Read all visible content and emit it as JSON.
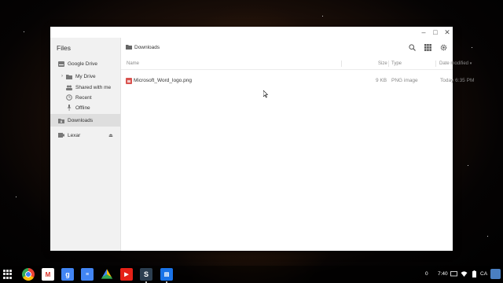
{
  "window": {
    "app_title": "Files",
    "controls": {
      "minimize": "–",
      "maximize": "□",
      "close": "✕"
    }
  },
  "sidebar": {
    "items": [
      {
        "label": "Google Drive",
        "icon": "drive-icon"
      },
      {
        "label": "My Drive",
        "icon": "folder-icon"
      },
      {
        "label": "Shared with me",
        "icon": "people-icon"
      },
      {
        "label": "Recent",
        "icon": "clock-icon"
      },
      {
        "label": "Offline",
        "icon": "pin-icon"
      },
      {
        "label": "Downloads",
        "icon": "downloads-folder-icon",
        "active": true
      },
      {
        "label": "Lexar",
        "icon": "usb-drive-icon"
      }
    ]
  },
  "toolbar": {
    "breadcrumb": "Downloads"
  },
  "columns": {
    "name": "Name",
    "size": "Size",
    "type": "Type",
    "date": "Date modified"
  },
  "files": [
    {
      "name": "Microsoft_Word_logo.png",
      "size": "9 KB",
      "type": "PNG image",
      "date": "Today 6:35 PM"
    }
  ],
  "shelf": {
    "notifications": "0",
    "time": "7:40",
    "locale": "CA"
  },
  "colors": {
    "active_nav": "#dedede",
    "sidebar_bg": "#f1f1f1",
    "accent_red": "#d9534f"
  }
}
